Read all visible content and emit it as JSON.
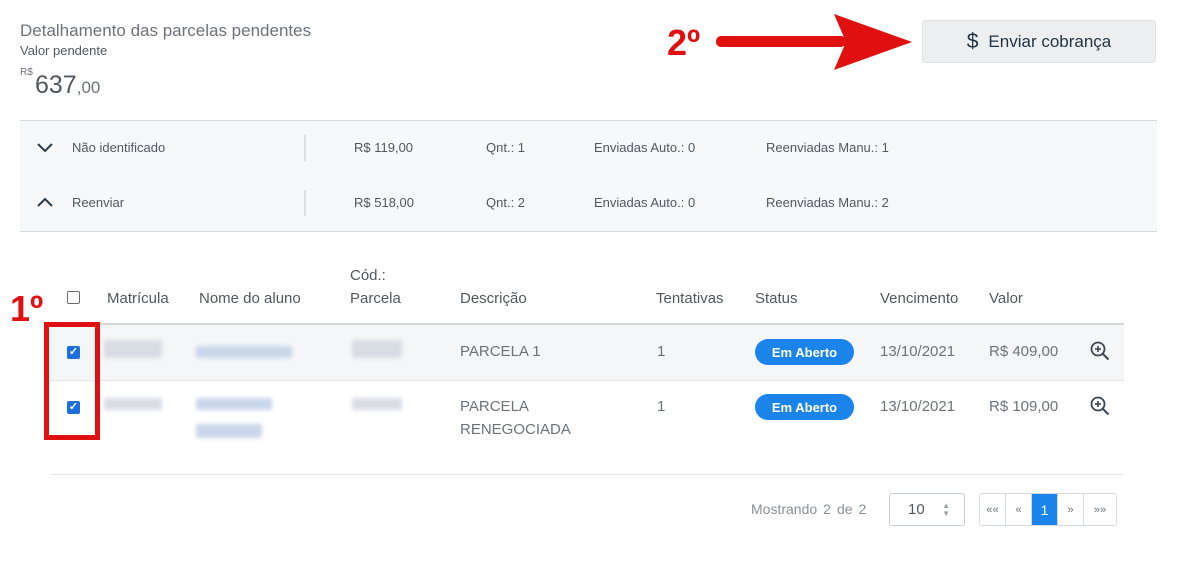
{
  "header": {
    "title": "Detalhamento das parcelas pendentes",
    "pending_label": "Valor pendente",
    "currency": "R$",
    "amount_int": "637",
    "amount_cents": ",00",
    "send_button": "Enviar cobrança",
    "send_icon": "dollar-icon"
  },
  "annotations": {
    "step1": "1º",
    "step2": "2º"
  },
  "groups": [
    {
      "label": "Não identificado",
      "value": "R$ 119,00",
      "qnt": "Qnt.: 1",
      "auto": "Enviadas Auto.: 0",
      "manual": "Reenviadas Manu.: 1",
      "expanded": false
    },
    {
      "label": "Reenviar",
      "value": "R$ 518,00",
      "qnt": "Qnt.: 2",
      "auto": "Enviadas Auto.: 0",
      "manual": "Reenviadas Manu.: 2",
      "expanded": true
    }
  ],
  "table": {
    "columns": {
      "matricula": "Matrícula",
      "nome": "Nome do aluno",
      "cod_line1": "Cód.:",
      "cod_line2": "Parcela",
      "descricao": "Descrição",
      "tentativas": "Tentativas",
      "status": "Status",
      "vencimento": "Vencimento",
      "valor": "Valor"
    },
    "rows": [
      {
        "checked": true,
        "descricao_line1": "PARCELA 1",
        "descricao_line2": "",
        "tentativas": "1",
        "status": "Em Aberto",
        "vencimento": "13/10/2021",
        "valor": "R$ 409,00"
      },
      {
        "checked": true,
        "descricao_line1": "PARCELA",
        "descricao_line2": "RENEGOCIADA",
        "tentativas": "1",
        "status": "Em Aberto",
        "vencimento": "13/10/2021",
        "valor": "R$ 109,00"
      }
    ]
  },
  "pagination": {
    "showing_label": "Mostrando",
    "count": "2",
    "of_label": "de",
    "total": "2",
    "page_size": "10",
    "first": "««",
    "prev": "«",
    "current": "1",
    "next": "»",
    "last": "»»"
  },
  "colors": {
    "accent": "#1b84ea",
    "annotation": "#e01010"
  }
}
